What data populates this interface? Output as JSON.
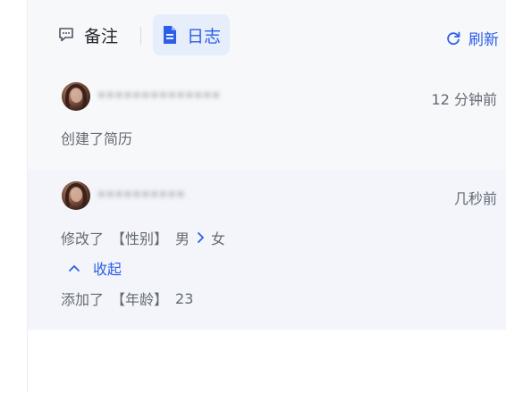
{
  "tabs": {
    "notes_label": "备注",
    "log_label": "日志",
    "active": "log"
  },
  "toolbar": {
    "refresh_label": "刷新"
  },
  "entries": [
    {
      "user_masked": "••••••••••••••",
      "time": "12 分钟前",
      "action": "创建了简历"
    },
    {
      "user_masked": "••••••••••",
      "time": "几秒前",
      "change": {
        "verb": "修改了",
        "field": "【性别】",
        "from": "男",
        "to": "女"
      },
      "collapse_label": "收起",
      "added": {
        "verb": "添加了",
        "field": "【年龄】",
        "value": "23"
      }
    }
  ],
  "colors": {
    "accent": "#2c5ee8",
    "active_tab_bg": "#e6eefc",
    "muted_text": "#646a73",
    "primary_text": "#1f2329"
  },
  "icons": {
    "notes": "comment-icon",
    "log": "document-icon",
    "refresh": "refresh-icon",
    "arrow": "chevron-right-icon",
    "collapse": "chevron-up-icon"
  }
}
